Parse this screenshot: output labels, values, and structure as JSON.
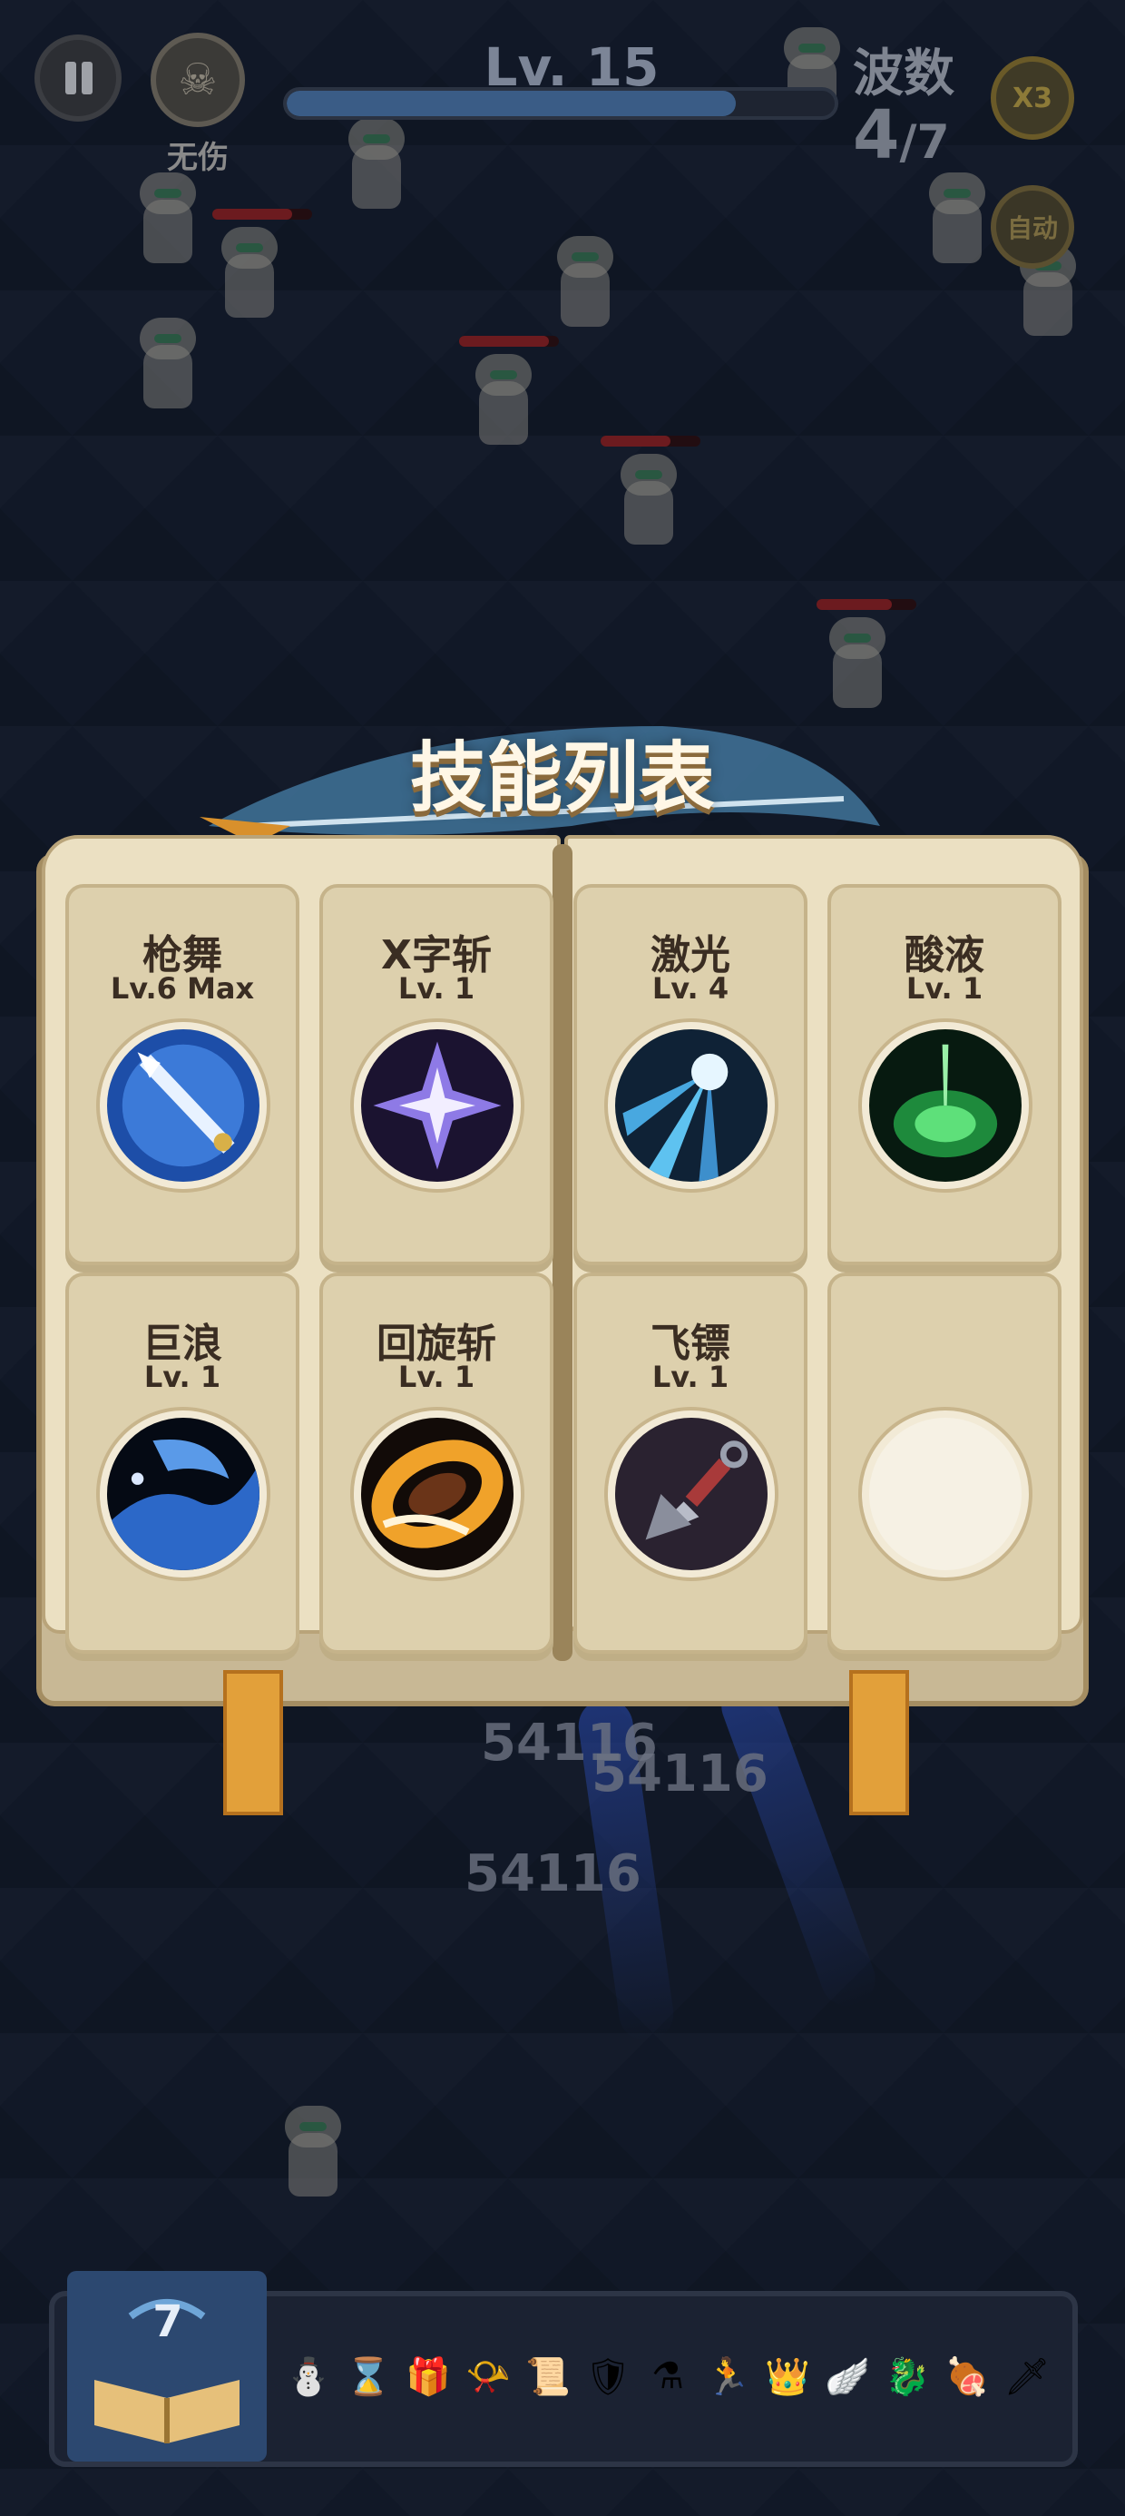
{
  "hud": {
    "no_damage_label": "无伤",
    "level": "Lv. 15",
    "xp_progress": 0.82,
    "wave_label": "波数",
    "wave_current": "4",
    "wave_total": "/7",
    "speed_label": "X3",
    "auto_label": "自动"
  },
  "skill_book": {
    "title": "技能列表",
    "skills": [
      {
        "name": "枪舞",
        "level": "Lv.6 Max",
        "icon": "spear-dance-icon"
      },
      {
        "name": "X字斩",
        "level": "Lv. 1",
        "icon": "x-slash-icon"
      },
      {
        "name": "激光",
        "level": "Lv. 4",
        "icon": "laser-icon"
      },
      {
        "name": "酸液",
        "level": "Lv. 1",
        "icon": "acid-icon"
      },
      {
        "name": "巨浪",
        "level": "Lv. 1",
        "icon": "giant-wave-icon"
      },
      {
        "name": "回旋斩",
        "level": "Lv. 1",
        "icon": "spin-slash-icon"
      },
      {
        "name": "飞镖",
        "level": "Lv. 1",
        "icon": "kunai-icon"
      },
      {
        "name": "",
        "level": "",
        "icon": "empty-slot"
      }
    ]
  },
  "damage_numbers": [
    "54116",
    "54116",
    "54116"
  ],
  "inventory": {
    "book_count": "7",
    "items": [
      "snowman-icon",
      "hourglass-icon",
      "gift-icon",
      "horn-icon",
      "scroll-icon",
      "shield-icon",
      "flask-icon",
      "runner-icon",
      "crown-icon",
      "wing-icon",
      "dragonfly-icon",
      "meat-icon",
      "dagger-icon"
    ]
  },
  "colors": {
    "background": "#1a2438",
    "book_page": "#ebe0c2",
    "card": "#ddd0ad",
    "text_dark": "#3a2d22",
    "xp_fill": "#3a5c86",
    "hp_fill": "#c02828"
  }
}
